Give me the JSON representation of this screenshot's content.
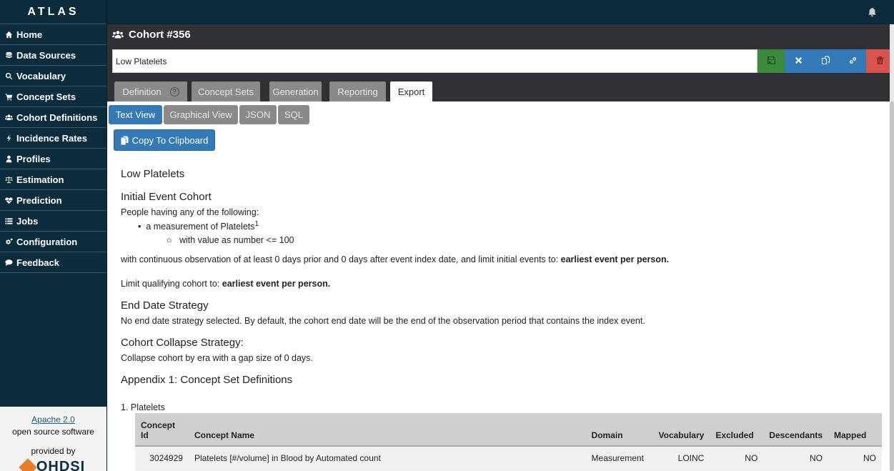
{
  "app": {
    "brand": "ATLAS"
  },
  "sidebar": {
    "items": [
      {
        "label": "Home",
        "icon": "home-icon"
      },
      {
        "label": "Data Sources",
        "icon": "database-icon"
      },
      {
        "label": "Vocabulary",
        "icon": "search-icon"
      },
      {
        "label": "Concept Sets",
        "icon": "cart-icon"
      },
      {
        "label": "Cohort Definitions",
        "icon": "users-icon"
      },
      {
        "label": "Incidence Rates",
        "icon": "bolt-icon"
      },
      {
        "label": "Profiles",
        "icon": "user-icon"
      },
      {
        "label": "Estimation",
        "icon": "balance-scale-icon"
      },
      {
        "label": "Prediction",
        "icon": "heartbeat-icon"
      },
      {
        "label": "Jobs",
        "icon": "list-icon"
      },
      {
        "label": "Configuration",
        "icon": "gears-icon"
      },
      {
        "label": "Feedback",
        "icon": "comment-icon"
      }
    ],
    "footer": {
      "license": "Apache 2.0",
      "oss": "open source software",
      "provided_by": "provided by",
      "org": "OHDSI"
    }
  },
  "topbar": {
    "icon": "bell-icon"
  },
  "cohort": {
    "title": "Cohort #356",
    "name_value": "Low Platelets",
    "actions": [
      "save-icon",
      "close-icon",
      "copy-icon",
      "link-icon",
      "trash-icon"
    ],
    "tabs": [
      "Definition",
      "Concept Sets",
      "Generation",
      "Reporting",
      "Export"
    ],
    "active_tab": "Export",
    "help_glyph": "?"
  },
  "export": {
    "subtabs": [
      "Text View",
      "Graphical View",
      "JSON",
      "SQL"
    ],
    "active_subtab": "Text View",
    "copy_label": "Copy To Clipboard"
  },
  "document": {
    "title": "Low Platelets",
    "initial_heading": "Initial Event Cohort",
    "people_having": "People having any of the following:",
    "criteria": "a measurement of Platelets",
    "criteria_sup": "1",
    "sub_criteria": "with value as number <= 100",
    "continuous_obs_prefix": "with continuous observation of at least 0 days prior and 0 days after event index date, and limit initial events to: ",
    "continuous_obs_bold": "earliest event per person.",
    "limit_prefix": "Limit qualifying cohort to: ",
    "limit_bold": "earliest event per person.",
    "end_date_heading": "End Date Strategy",
    "end_date_text": "No end date strategy selected. By default, the cohort end date will be the end of the observation period that contains the index event.",
    "collapse_heading": "Cohort Collapse Strategy:",
    "collapse_text": "Collapse cohort by era with a gap size of 0 days.",
    "appendix_heading": "Appendix 1: Concept Set Definitions",
    "concept_set_title": "1. Platelets"
  },
  "concept_table": {
    "headers": [
      "Concept Id",
      "Concept Name",
      "Domain",
      "Vocabulary",
      "Excluded",
      "Descendants",
      "Mapped"
    ],
    "rows": [
      [
        "3024929",
        "Platelets [#/volume] in Blood by Automated count",
        "Measurement",
        "LOINC",
        "NO",
        "NO",
        "NO"
      ]
    ]
  }
}
